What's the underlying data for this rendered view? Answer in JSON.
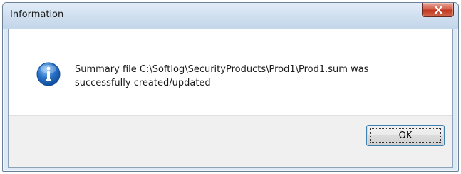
{
  "window": {
    "title": "Information"
  },
  "dialog": {
    "icon": "info-icon",
    "message": "Summary file C:\\Softlog\\SecurityProducts\\Prod1\\Prod1.sum was\nsuccessfully created/updated",
    "ok_label": "OK"
  },
  "colors": {
    "accent": "#3c7fb1",
    "close": "#c1371f"
  }
}
